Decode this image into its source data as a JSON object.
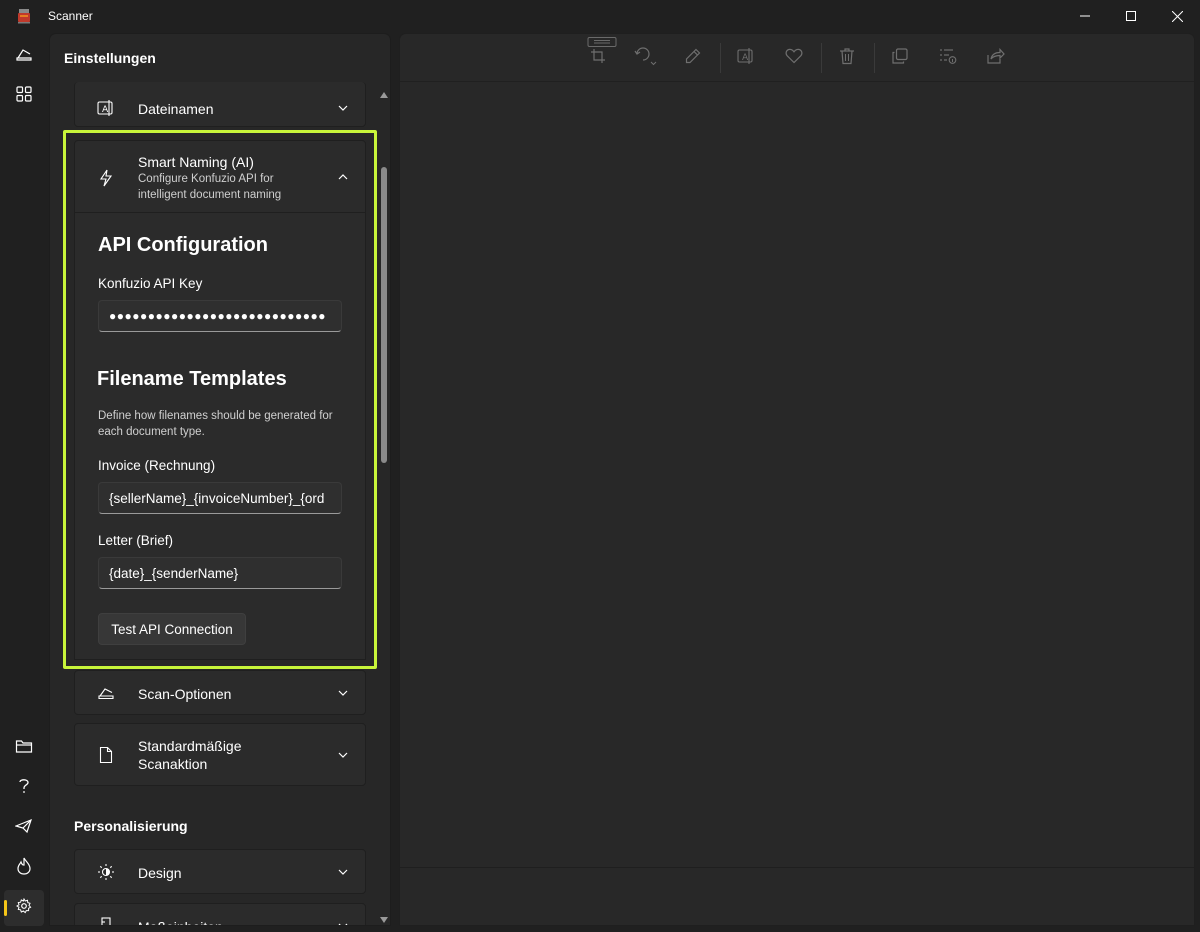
{
  "window": {
    "title": "Scanner"
  },
  "settings": {
    "header": "Einstellungen",
    "dateinamen": {
      "title": "Dateinamen"
    },
    "smart_naming": {
      "title": "Smart Naming (AI)",
      "description": "Configure Konfuzio API for intelligent document naming",
      "api_config_heading": "API Configuration",
      "api_key_label": "Konfuzio API Key",
      "api_key_value": "●●●●●●●●●●●●●●●●●●●●●●●●●●●●",
      "templates_heading": "Filename Templates",
      "templates_description": "Define how filenames should be generated for each document type.",
      "invoice_label": "Invoice (Rechnung)",
      "invoice_value": "{sellerName}_{invoiceNumber}_{ord",
      "letter_label": "Letter (Brief)",
      "letter_value": "{date}_{senderName}",
      "test_button": "Test API Connection"
    },
    "scan_options": {
      "title": "Scan-Optionen"
    },
    "default_action": {
      "title_line1": "Standardmäßige",
      "title_line2": "Scanaktion"
    },
    "personalization": {
      "heading": "Personalisierung",
      "design": {
        "title": "Design"
      },
      "units": {
        "title": "Maßeinheiten"
      }
    }
  },
  "colors": {
    "highlight": "#c8f53a",
    "accent": "#f5c518"
  }
}
